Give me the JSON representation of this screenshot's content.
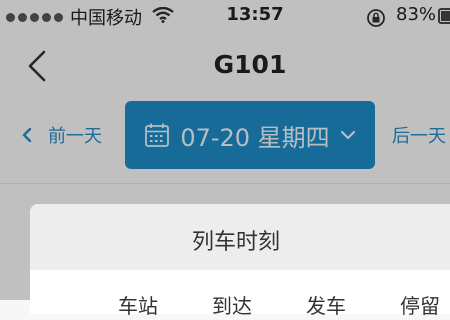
{
  "status_bar": {
    "carrier": "中国移动",
    "time": "13:57",
    "battery_percent": "83%",
    "battery_level": 0.83
  },
  "nav": {
    "title": "G101"
  },
  "date_bar": {
    "prev_label": "前一天",
    "date_label": "07-20 星期四",
    "next_label": "后一天",
    "accent_color": "#1e8ac4"
  },
  "schedule_sheet": {
    "title": "列车时刻",
    "columns": [
      "车站",
      "到达",
      "发车",
      "停留"
    ]
  },
  "icons": [
    "signal-icon",
    "wifi-icon",
    "rotation-lock-icon",
    "battery-icon",
    "back-chevron-icon",
    "calendar-icon",
    "chevron-down-icon"
  ]
}
